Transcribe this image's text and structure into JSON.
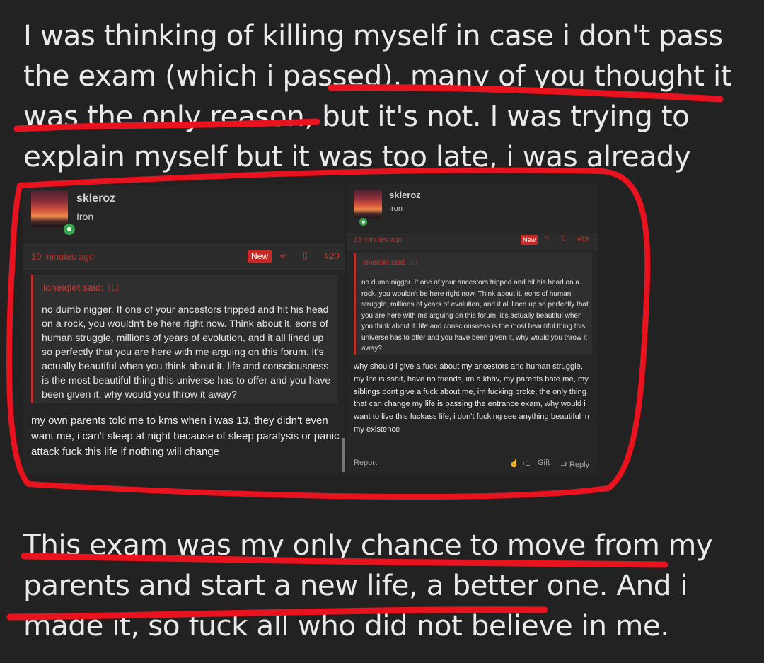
{
  "intro_text": "I was thinking of killing myself in case i don't pass the exam (which i passed), many of you thought it was the only reason, but it's not. I was trying to explain myself but it was too late, i was already being made fun of.",
  "outro_text": "This exam was my only chance to move from my parents and start a new life, a better one. And i made it, so fuck all who did not believe in me.",
  "posts": [
    {
      "username": "skleroz",
      "rank": "Iron",
      "time": "10 minutes ago",
      "badge": "New",
      "post_number": "#20",
      "quote_author": "loneiqlet said:",
      "quote_text": "no dumb nigger. If one of your ancestors tripped and hit his head on a rock, you wouldn't be here right now. Think about it, eons of human struggle, millions of years of evolution, and it all lined up so perfectly that you are here with me arguing on this forum. it's actually beautiful when you think about it. life and consciousness is the most beautiful thing this universe has to offer and you have been given it, why would you throw it away?",
      "reply_text": "my own parents told me to kms when i was 13, they didn't even want me, i can't sleep at night because of sleep paralysis or panic attack fuck this life if nothing will change"
    },
    {
      "username": "skleroz",
      "rank": "Iron",
      "time": "13 minutes ago",
      "badge": "New",
      "post_number": "#19",
      "quote_author": "loneiqlet said:",
      "quote_text": "no dumb nigger. If one of your ancestors tripped and hit his head on a rock, you wouldn't be here right now. Think about it, eons of human struggle, millions of years of evolution, and it all lined up so perfectly that you are here with me arguing on this forum. it's actually beautiful when you think about it. life and consciousness is the most beautiful thing this universe has to offer and you have been given it, why would you throw it away?",
      "reply_text": "why should i give a fuck about my ancestors and human struggle, my life is sshit, have no friends, im a khhv, my parents hate me, my siblings dont give a fuck about me, im fucking broke, the only thing that can change my life is passing the entrance exam, why would i want to live this fuckass life, i don't fucking see anything beautiful in my existence",
      "footer": {
        "report": "Report",
        "reactions": "+1",
        "gift": "Gift",
        "reply": "Reply"
      }
    }
  ],
  "icons": {
    "share": "share-icon",
    "bookmark": "bookmark-icon",
    "quote_arrow": "arrow-up-circle-icon",
    "like": "thumbs-up-icon",
    "reply": "reply-icon",
    "status": "online-status-icon"
  },
  "colors": {
    "background": "#222222",
    "accent_red": "#c62a26",
    "annotation_red": "#e8131e",
    "online_green": "#3aa24c"
  }
}
